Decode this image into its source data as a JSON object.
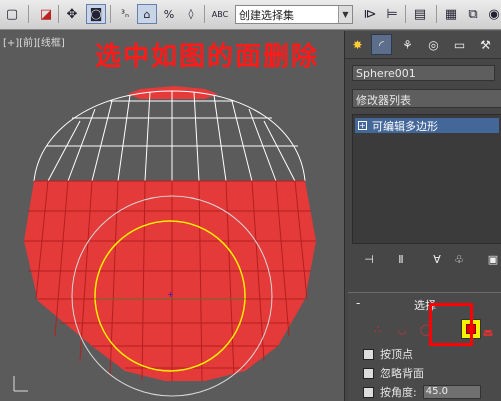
{
  "toolbar": {
    "selection_set_placeholder": "创建选择集"
  },
  "viewport": {
    "label": "[+][前][线框]",
    "instruction": "选中如图的面删除"
  },
  "panel": {
    "object_name": "Sphere001",
    "modifier_list": "修改器列表",
    "stack_item": "可编辑多边形",
    "selection_title": "选择",
    "options": {
      "by_vertex": "按顶点",
      "ignore_backfacing": "忽略背面",
      "by_angle": "按角度:",
      "angle_value": "45.0"
    }
  },
  "colors": {
    "selected_face": "#e43a3a",
    "wire": "#ffffff",
    "selection_highlight": "#ff0000",
    "face_button": "#f7f200"
  }
}
